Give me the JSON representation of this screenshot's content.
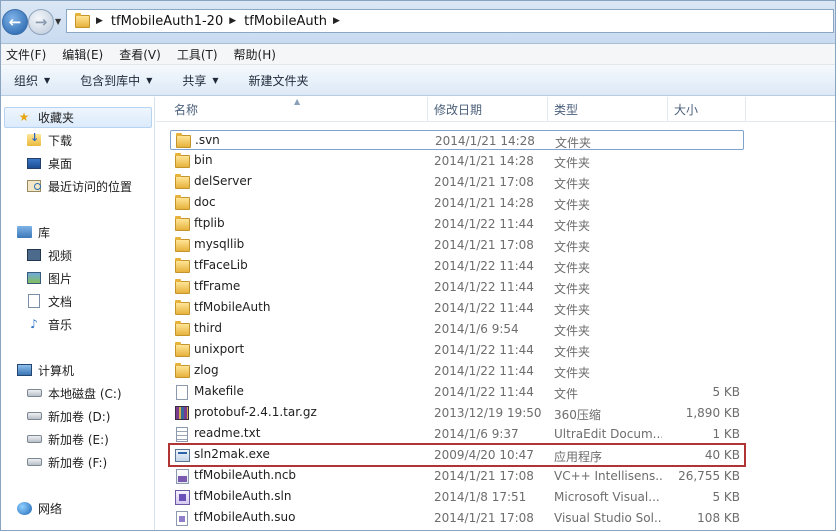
{
  "address": {
    "crumbs": [
      "tfMobileAuth1-20",
      "tfMobileAuth"
    ]
  },
  "menu": [
    "文件(F)",
    "编辑(E)",
    "查看(V)",
    "工具(T)",
    "帮助(H)"
  ],
  "commands": {
    "organize": "组织",
    "include_library": "包含到库中",
    "share": "共享",
    "new_folder": "新建文件夹"
  },
  "nav": {
    "favorites": "收藏夹",
    "downloads": "下载",
    "desktop": "桌面",
    "recent": "最近访问的位置",
    "libraries": "库",
    "videos": "视频",
    "pictures": "图片",
    "documents": "文档",
    "music": "音乐",
    "computer": "计算机",
    "drive_c": "本地磁盘 (C:)",
    "drive_d": "新加卷 (D:)",
    "drive_e": "新加卷 (E:)",
    "drive_f": "新加卷 (F:)",
    "network": "网络"
  },
  "columns": {
    "name": "名称",
    "date": "修改日期",
    "type": "类型",
    "size": "大小"
  },
  "files": [
    {
      "name": ".svn",
      "date": "2014/1/21 14:28",
      "type": "文件夹",
      "size": "",
      "icon": "folder-icon"
    },
    {
      "name": "bin",
      "date": "2014/1/21 14:28",
      "type": "文件夹",
      "size": "",
      "icon": "folder-icon"
    },
    {
      "name": "delServer",
      "date": "2014/1/21 17:08",
      "type": "文件夹",
      "size": "",
      "icon": "folder-icon"
    },
    {
      "name": "doc",
      "date": "2014/1/21 14:28",
      "type": "文件夹",
      "size": "",
      "icon": "folder-icon"
    },
    {
      "name": "ftplib",
      "date": "2014/1/22 11:44",
      "type": "文件夹",
      "size": "",
      "icon": "folder-icon"
    },
    {
      "name": "mysqllib",
      "date": "2014/1/21 17:08",
      "type": "文件夹",
      "size": "",
      "icon": "folder-icon"
    },
    {
      "name": "tfFaceLib",
      "date": "2014/1/22 11:44",
      "type": "文件夹",
      "size": "",
      "icon": "folder-icon"
    },
    {
      "name": "tfFrame",
      "date": "2014/1/22 11:44",
      "type": "文件夹",
      "size": "",
      "icon": "folder-icon"
    },
    {
      "name": "tfMobileAuth",
      "date": "2014/1/22 11:44",
      "type": "文件夹",
      "size": "",
      "icon": "folder-icon"
    },
    {
      "name": "third",
      "date": "2014/1/6 9:54",
      "type": "文件夹",
      "size": "",
      "icon": "folder-icon"
    },
    {
      "name": "unixport",
      "date": "2014/1/22 11:44",
      "type": "文件夹",
      "size": "",
      "icon": "folder-icon"
    },
    {
      "name": "zlog",
      "date": "2014/1/22 11:44",
      "type": "文件夹",
      "size": "",
      "icon": "folder-icon"
    },
    {
      "name": "Makefile",
      "date": "2014/1/22 11:44",
      "type": "文件",
      "size": "5 KB",
      "icon": "file-icon"
    },
    {
      "name": "protobuf-2.4.1.tar.gz",
      "date": "2013/12/19 19:50",
      "type": "360压缩",
      "size": "1,890 KB",
      "icon": "archive-icon"
    },
    {
      "name": "readme.txt",
      "date": "2014/1/6 9:37",
      "type": "UltraEdit Docum...",
      "size": "1 KB",
      "icon": "text-file-icon"
    },
    {
      "name": "sln2mak.exe",
      "date": "2009/4/20 10:47",
      "type": "应用程序",
      "size": "40 KB",
      "icon": "exe-icon"
    },
    {
      "name": "tfMobileAuth.ncb",
      "date": "2014/1/21 17:08",
      "type": "VC++ Intellisens...",
      "size": "26,755 KB",
      "icon": "ncb-file-icon"
    },
    {
      "name": "tfMobileAuth.sln",
      "date": "2014/1/8 17:51",
      "type": "Microsoft Visual...",
      "size": "5 KB",
      "icon": "sln-file-icon"
    },
    {
      "name": "tfMobileAuth.suo",
      "date": "2014/1/21 17:08",
      "type": "Visual Studio Sol...",
      "size": "108 KB",
      "icon": "suo-file-icon"
    }
  ]
}
